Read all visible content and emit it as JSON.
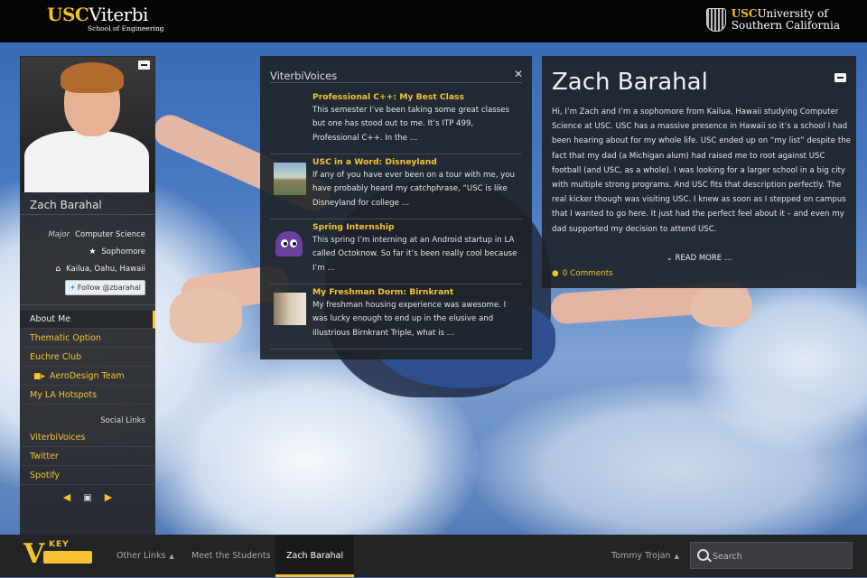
{
  "header": {
    "left_brand": {
      "usc": "USC",
      "viterbi": "Viterbi",
      "sub": "School of Engineering"
    },
    "right_brand": {
      "usc": "USC",
      "line1": "University of",
      "line2": "Southern California"
    }
  },
  "profile": {
    "name": "Zach Barahal",
    "major_key": "Major",
    "major_value": "Computer Science",
    "year": "Sophomore",
    "hometown": "Kailua, Oahu, Hawaii",
    "follow_label": "Follow @zbarahal"
  },
  "sidebar": {
    "items": [
      {
        "label": "About Me",
        "active": true
      },
      {
        "label": "Thematic Option"
      },
      {
        "label": "Euchre Club"
      },
      {
        "label": "AeroDesign Team",
        "icon": "video-camera-icon"
      },
      {
        "label": "My LA Hotspots"
      }
    ],
    "social_heading": "Social Links",
    "social": [
      {
        "label": "ViterbiVoices"
      },
      {
        "label": "Twitter"
      },
      {
        "label": "Spotify"
      }
    ]
  },
  "voices": {
    "title": "ViterbiVoices",
    "posts": [
      {
        "title": "Professional C++: My Best Class",
        "body": "This semester I’ve been taking some great classes but one has stood out to me. It’s ITP 499, Professional C++. In the …",
        "thumb": "none"
      },
      {
        "title": "USC in a Word: Disneyland",
        "body": "If any of you have ever been on a tour with me, you have probably heard my catchphrase, “USC is like Disneyland for college …",
        "thumb": "landscape"
      },
      {
        "title": "Spring Internship",
        "body": "This spring I’m interning at an Android startup in LA called Octoknow. So far it’s been really cool because I’m …",
        "thumb": "purple-monster"
      },
      {
        "title": "My Freshman Dorm: Birnkrant",
        "body": "My freshman housing experience was awesome. I was lucky enough to end up in the elusive and illustrious Birnkrant Triple, what is …",
        "thumb": "dorm-room"
      }
    ]
  },
  "about": {
    "heading": "Zach Barahal",
    "body": "Hi, I’m Zach and I’m a sophomore from Kailua, Hawaii studying Computer Science at USC. USC has a massive presence in Hawaii so it’s a school I had been hearing about for my whole life. USC ended up on “my list” despite the fact that my dad (a Michigan alum) had raised me to root against USC football (and USC, as a whole). I was looking for a larger school in a big city with multiple strong programs. And USC fits that description perfectly. The real kicker though was visiting USC. I knew as soon as I stepped on campus that I wanted to go here.  It just had the perfect feel about it – and even my dad supported my decision to attend USC.",
    "read_more": "READ MORE …",
    "comments": "0 Comments"
  },
  "bottom": {
    "logo_text": "KEY",
    "nav": [
      {
        "label": "Other Links",
        "caret": true
      },
      {
        "label": "Meet the Students"
      },
      {
        "label": "Zach Barahal",
        "active": true
      }
    ],
    "user": "Tommy Trojan",
    "search_placeholder": "Search"
  },
  "colors": {
    "accent": "#f5c332",
    "panel": "#1e2126",
    "topbar": "#050505"
  }
}
